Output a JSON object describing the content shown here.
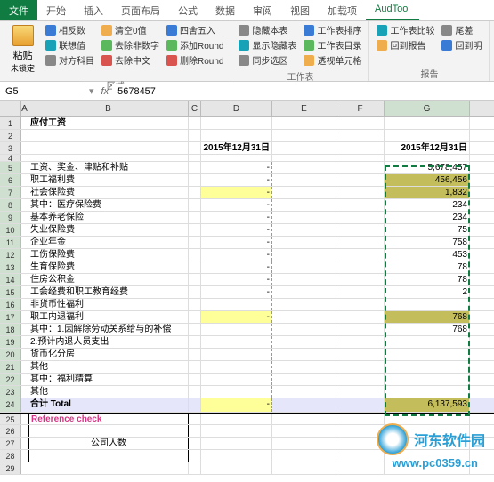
{
  "tabs": {
    "file": "文件",
    "start": "开始",
    "insert": "插入",
    "layout": "页面布局",
    "formula": "公式",
    "data": "数据",
    "review": "审阅",
    "view": "视图",
    "addin": "加载项",
    "audtool": "AudTool"
  },
  "ribbon": {
    "paste": "粘贴",
    "paste_sub": "未锁定",
    "g1": {
      "a": "相反数",
      "b": "联想值",
      "c": "对方科目",
      "label": "区域"
    },
    "g2": {
      "a": "清空0值",
      "b": "去除非数字",
      "c": "去除中文"
    },
    "g3": {
      "a": "四舍五入",
      "b": "添加Round",
      "c": "删除Round"
    },
    "g4": {
      "a": "隐藏本表",
      "b": "显示隐藏表",
      "c": "同步选区",
      "label": "工作表"
    },
    "g5": {
      "a": "工作表排序",
      "b": "工作表目录",
      "c": "透视单元格"
    },
    "g6": {
      "a": "工作表比较",
      "b": "回到报告",
      "c": "回到明",
      "label": "报告"
    },
    "g7": {
      "a": "尾差"
    }
  },
  "namebox": "G5",
  "formula": "5678457",
  "cols": {
    "A": "A",
    "B": "B",
    "C": "C",
    "D": "D",
    "E": "E",
    "F": "F",
    "G": "G"
  },
  "rows": {
    "1": {
      "B": "应付工资"
    },
    "2": {},
    "3": {
      "D": "2015年12月31日",
      "G": "2015年12月31日"
    },
    "4": {},
    "5": {
      "B": "工资、奖金、津贴和补贴",
      "D": "-",
      "G": "5,678,457"
    },
    "6": {
      "B": "职工福利费",
      "D": "-",
      "G": "456,456"
    },
    "7": {
      "B": "社会保险费",
      "D": "-",
      "G": "1,832"
    },
    "8": {
      "B": "其中：医疗保险费",
      "D": "-",
      "G": "234"
    },
    "9": {
      "B": "    基本养老保险",
      "D": "-",
      "G": "234"
    },
    "10": {
      "B": "    失业保险费",
      "D": "-",
      "G": "75"
    },
    "11": {
      "B": "    企业年金",
      "D": "-",
      "G": "758"
    },
    "12": {
      "B": "    工伤保险费",
      "D": "-",
      "G": "453"
    },
    "13": {
      "B": "    生育保险费",
      "D": "-",
      "G": "78"
    },
    "14": {
      "B": "住房公积金",
      "D": "-",
      "G": "78"
    },
    "15": {
      "B": "工会经费和职工教育经费",
      "D": "-",
      "G": "2"
    },
    "16": {
      "B": "非货币性福利",
      "D": "",
      "G": ""
    },
    "17": {
      "B": "职工内退福利",
      "D": "-",
      "G": "768"
    },
    "18": {
      "B": "其中：1.因解除劳动关系给与的补偿",
      "D": "",
      "G": "768"
    },
    "19": {
      "B": "      2.预计内退人员支出",
      "D": "",
      "G": ""
    },
    "20": {
      "B": "货币化分房",
      "D": "",
      "G": ""
    },
    "21": {
      "B": "其他",
      "D": "",
      "G": ""
    },
    "22": {
      "B": "其中：福利精算",
      "D": "",
      "G": ""
    },
    "23": {
      "B": "         其他",
      "D": "",
      "G": ""
    },
    "24": {
      "B": "合计 Total",
      "D": "-",
      "G": "6,137,593"
    },
    "25": {
      "B": "Reference check"
    },
    "26": {},
    "27": {
      "B": "公司人数"
    },
    "28": {},
    "29": {}
  },
  "watermark": {
    "text": "河东软件园",
    "url": "www.pc0359.cn"
  }
}
